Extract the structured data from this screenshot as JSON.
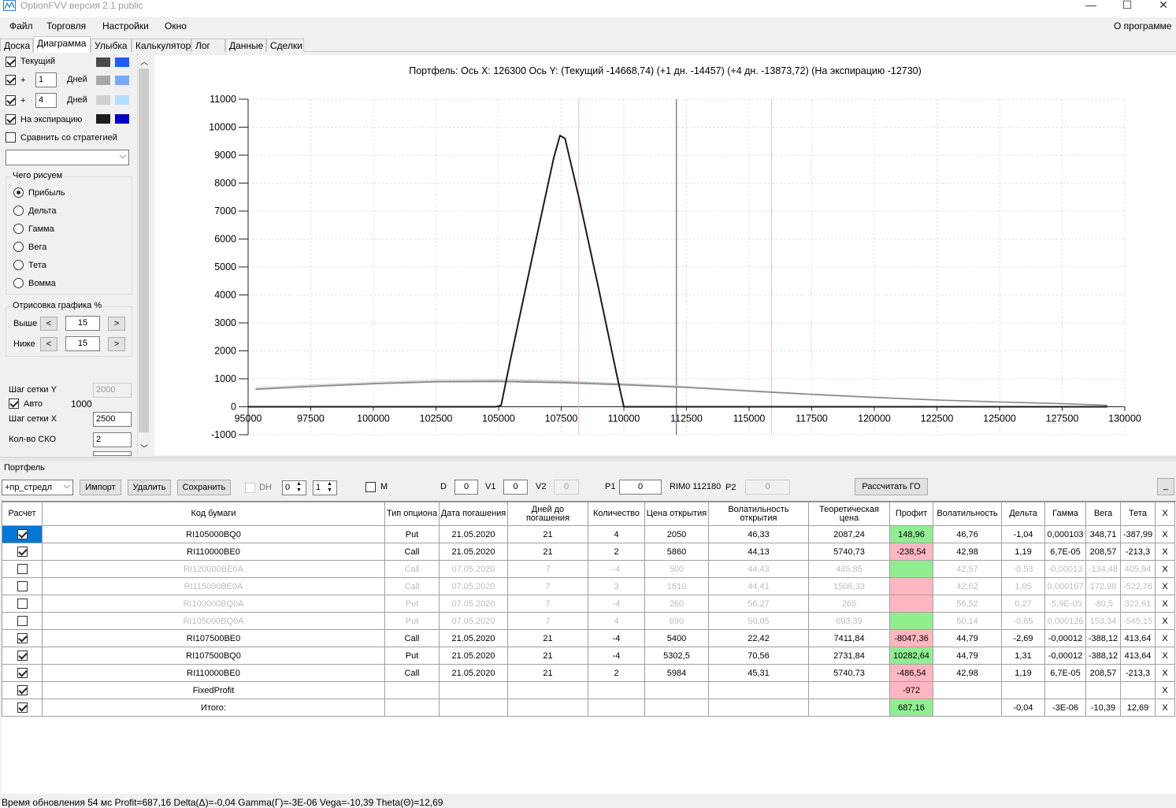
{
  "window": {
    "title": "OptionFVV версия 2.1 public",
    "min": "—",
    "max": "☐",
    "close": "✕"
  },
  "menu": {
    "file": "Файл",
    "trade": "Торговля",
    "settings": "Настройки",
    "window": "Окно",
    "about": "О программе"
  },
  "tabs": [
    "Доска",
    "Диаграмма",
    "Улыбка",
    "Калькулятор",
    "Лог",
    "Данные",
    "Сделки"
  ],
  "left": {
    "current": "Текущий",
    "plus": "+",
    "days1": "1",
    "days2": "4",
    "days_label": "Дней",
    "expiration": "На экспирацию",
    "compare": "Сравнить со стратегией",
    "what_title": "Чего рисуем",
    "radios": [
      "Прибыль",
      "Дельта",
      "Гамма",
      "Вега",
      "Тета",
      "Вомма"
    ],
    "draw_title": "Отрисовка графика %",
    "above": "Выше",
    "below": "Ниже",
    "above_val": "15",
    "below_val": "15",
    "lt": "<",
    "gt": ">",
    "grid_y": "Шаг сетки Y",
    "grid_y_val": "2000",
    "auto": "Авто",
    "auto_val": "1000",
    "grid_x": "Шаг сетки X",
    "grid_x_val": "2500",
    "sko": "Кол-во СКО",
    "sko_val": "2",
    "colors": {
      "cur_dark": "#4a4a4a",
      "cur_light": "#1f5cff",
      "d1_dark": "#a8a8a8",
      "d1_light": "#78a9ff",
      "d4_dark": "#cfcfcf",
      "d4_light": "#b3deff",
      "exp_dark": "#1e1e1e",
      "exp_light": "#0000c8"
    }
  },
  "chart_data": {
    "type": "line",
    "header": "Портфель: Ось X: 126300 Ось Y: (Текущий -14668,74) (+1 дн. -14457) (+4 дн. -13873,72) (На экспирацию -12730)",
    "xlim": [
      95000,
      130000
    ],
    "ylim": [
      -1000,
      11000
    ],
    "xticks": [
      95000,
      97500,
      100000,
      102500,
      105000,
      107500,
      110000,
      112500,
      115000,
      117500,
      120000,
      122500,
      125000,
      127500,
      130000
    ],
    "yticks": [
      -1000,
      0,
      1000,
      2000,
      3000,
      4000,
      5000,
      6000,
      7000,
      8000,
      9000,
      10000,
      11000
    ],
    "vlines": [
      {
        "x": 108200,
        "color": "#f4b8c0"
      },
      {
        "x": 112100,
        "color": "#3a4a7a"
      },
      {
        "x": 115900,
        "color": "#f4b8c0"
      }
    ],
    "series": [
      {
        "color": "#1a1a1a",
        "width": 2,
        "points": [
          [
            95000,
            0
          ],
          [
            104900,
            0
          ],
          [
            105100,
            50
          ],
          [
            105500,
            1800
          ],
          [
            106500,
            6000
          ],
          [
            107200,
            8900
          ],
          [
            107450,
            9700
          ],
          [
            107650,
            9600
          ],
          [
            108200,
            7500
          ],
          [
            109000,
            4200
          ],
          [
            109800,
            800
          ],
          [
            110000,
            0
          ],
          [
            129300,
            0
          ]
        ]
      },
      {
        "color": "#888888",
        "width": 1.5,
        "points": [
          [
            95300,
            620
          ],
          [
            97500,
            720
          ],
          [
            100000,
            820
          ],
          [
            102500,
            890
          ],
          [
            105000,
            900
          ],
          [
            107500,
            860
          ],
          [
            110000,
            780
          ],
          [
            112500,
            690
          ],
          [
            115000,
            560
          ],
          [
            117500,
            440
          ],
          [
            120000,
            330
          ],
          [
            122500,
            240
          ],
          [
            125000,
            170
          ],
          [
            127500,
            110
          ],
          [
            129300,
            50
          ]
        ]
      },
      {
        "color": "#b0b0b0",
        "width": 1.2,
        "points": [
          [
            95300,
            640
          ],
          [
            97500,
            740
          ],
          [
            100000,
            840
          ],
          [
            102500,
            910
          ],
          [
            105000,
            930
          ],
          [
            107500,
            890
          ],
          [
            110000,
            800
          ],
          [
            112500,
            700
          ],
          [
            115000,
            570
          ],
          [
            117500,
            450
          ],
          [
            120000,
            340
          ],
          [
            122500,
            245
          ],
          [
            125000,
            175
          ],
          [
            127500,
            115
          ],
          [
            129300,
            55
          ]
        ]
      },
      {
        "color": "#d0d0d0",
        "width": 1.2,
        "points": [
          [
            95300,
            680
          ],
          [
            97500,
            780
          ],
          [
            100000,
            880
          ],
          [
            102500,
            950
          ],
          [
            105000,
            970
          ],
          [
            107500,
            930
          ],
          [
            110000,
            830
          ],
          [
            112500,
            720
          ],
          [
            115000,
            590
          ],
          [
            117500,
            460
          ],
          [
            120000,
            350
          ],
          [
            122500,
            250
          ],
          [
            125000,
            180
          ],
          [
            127500,
            120
          ],
          [
            129300,
            60
          ]
        ]
      }
    ]
  },
  "portfolio": {
    "label": "Портфель",
    "select": "+пр_стредл",
    "import": "Импорт",
    "delete": "Удалить",
    "save": "Сохранить",
    "dh": "DH",
    "spin1": "0",
    "spin2": "1",
    "m": "M",
    "d_label": "D",
    "d_val": "0",
    "v1_label": "V1",
    "v1_val": "0",
    "v2_label": "V2",
    "v2_val": "0",
    "p1_label": "P1",
    "p1_val": "0",
    "rim": "RIM0 112180",
    "p2_label": "P2",
    "p2_val": "0",
    "calc": "Рассчитать ГО",
    "collapse": "_"
  },
  "table": {
    "headers": [
      "Расчет",
      "Код бумаги",
      "Тип опциона",
      "Дата погашения",
      "Дней до погашения",
      "Количество",
      "Цена открытия",
      "Волатильность открытия",
      "Теоретическая цена",
      "Профит",
      "Волатильность",
      "Дельта",
      "Гамма",
      "Вега",
      "Тета",
      "X"
    ],
    "rows": [
      {
        "chk": true,
        "dim": false,
        "sel": true,
        "profit_bg": "pos",
        "cells": [
          "RI105000BQ0",
          "Put",
          "21.05.2020",
          "21",
          "4",
          "2050",
          "46,33",
          "2087,24",
          "148,96",
          "46,76",
          "-1,04",
          "0,000103",
          "348,71",
          "-387,99",
          "X"
        ]
      },
      {
        "chk": true,
        "dim": false,
        "sel": false,
        "profit_bg": "neg",
        "cells": [
          "RI110000BE0",
          "Call",
          "21.05.2020",
          "21",
          "2",
          "5860",
          "44,13",
          "5740,73",
          "-238,54",
          "42,98",
          "1,19",
          "6,7E-05",
          "208,57",
          "-213,3",
          "X"
        ]
      },
      {
        "chk": false,
        "dim": true,
        "sel": false,
        "profit_bg": "pos",
        "cells": [
          "RI120000BE0A",
          "Call",
          "07.05.2020",
          "7",
          "-4",
          "500",
          "44,43",
          "435,85",
          "",
          "42,57",
          "-0,53",
          "-0,00013",
          "-134,48",
          "405,94",
          "X"
        ]
      },
      {
        "chk": false,
        "dim": true,
        "sel": false,
        "profit_bg": "neg",
        "cells": [
          "RI115000BE0A",
          "Call",
          "07.05.2020",
          "7",
          "3",
          "1610",
          "44,41",
          "1506,33",
          "",
          "42,62",
          "1,05",
          "0,000167",
          "172,98",
          "-522,76",
          "X"
        ]
      },
      {
        "chk": false,
        "dim": true,
        "sel": false,
        "profit_bg": "neg",
        "cells": [
          "RI100000BQ0A",
          "Put",
          "07.05.2020",
          "7",
          "-4",
          "260",
          "56,27",
          "265",
          "",
          "56,52",
          "0,27",
          "-5,9E-05",
          "-80,5",
          "322,61",
          "X"
        ]
      },
      {
        "chk": false,
        "dim": true,
        "sel": false,
        "profit_bg": "pos",
        "cells": [
          "RI105000BQ0A",
          "Put",
          "07.05.2020",
          "7",
          "4",
          "690",
          "50,05",
          "693,39",
          "",
          "50,14",
          "-0,65",
          "0,000126",
          "153,34",
          "-545,15",
          "X"
        ]
      },
      {
        "chk": true,
        "dim": false,
        "sel": false,
        "profit_bg": "neg",
        "cells": [
          "RI107500BE0",
          "Call",
          "21.05.2020",
          "21",
          "-4",
          "5400",
          "22,42",
          "7411,84",
          "-8047,36",
          "44,79",
          "-2,69",
          "-0,00012",
          "-388,12",
          "413,64",
          "X"
        ]
      },
      {
        "chk": true,
        "dim": false,
        "sel": false,
        "profit_bg": "pos",
        "cells": [
          "RI107500BQ0",
          "Put",
          "21.05.2020",
          "21",
          "-4",
          "5302,5",
          "70,56",
          "2731,84",
          "10282,64",
          "44,79",
          "1,31",
          "-0,00012",
          "-388,12",
          "413,64",
          "X"
        ]
      },
      {
        "chk": true,
        "dim": false,
        "sel": false,
        "profit_bg": "neg",
        "cells": [
          "RI110000BE0",
          "Call",
          "21.05.2020",
          "21",
          "2",
          "5984",
          "45,31",
          "5740,73",
          "-486,54",
          "42,98",
          "1,19",
          "6,7E-05",
          "208,57",
          "-213,3",
          "X"
        ]
      },
      {
        "chk": true,
        "dim": false,
        "sel": false,
        "profit_bg": "neg",
        "cells": [
          "FixedProfit",
          "",
          "",
          "",
          "",
          "",
          "",
          "",
          "-972",
          "",
          "",
          "",
          "",
          "",
          "X"
        ]
      },
      {
        "chk": true,
        "dim": false,
        "sel": false,
        "profit_bg": "pos",
        "cells": [
          "Итого:",
          "",
          "",
          "",
          "",
          "",
          "",
          "",
          "687,16",
          "",
          "-0,04",
          "-3E-06",
          "-10,39",
          "12,69",
          "X"
        ]
      }
    ]
  },
  "status": "Время обновления 54 мс   Profit=687,16 Delta(Δ)=-0,04 Gamma(Γ)=-3E-06 Vega=-10,39 Theta(Θ)=12,69"
}
